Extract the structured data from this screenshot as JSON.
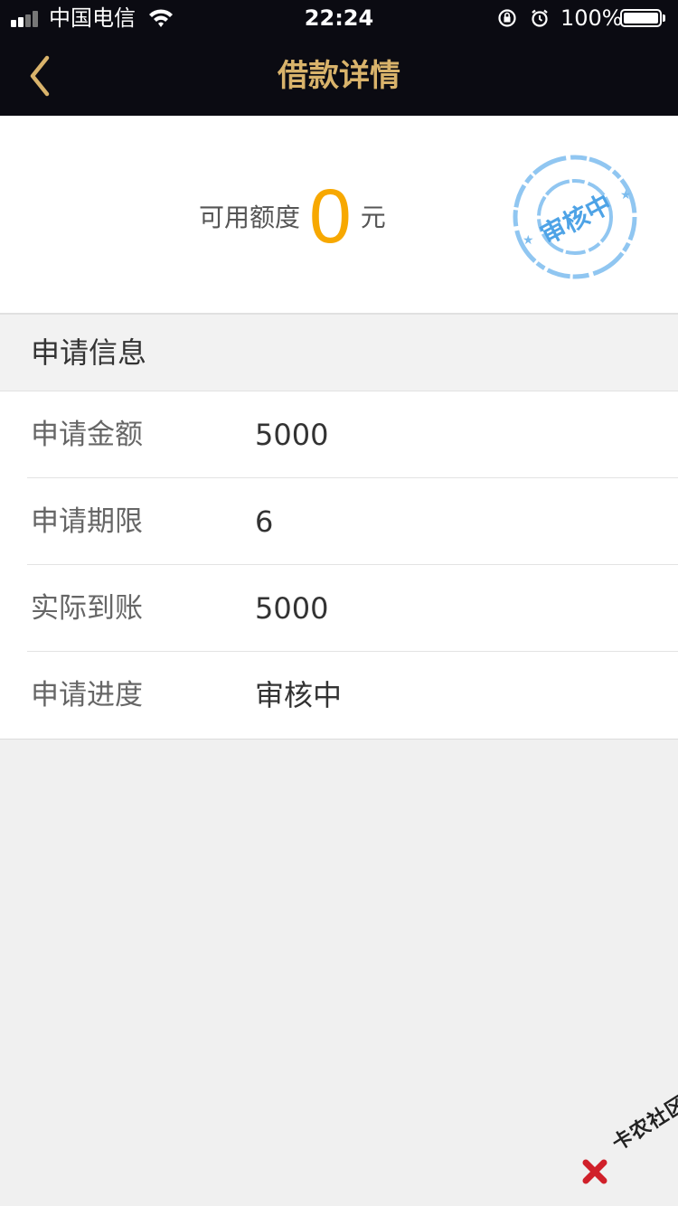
{
  "status_bar": {
    "carrier": "中国电信",
    "time": "22:24",
    "battery": "100%"
  },
  "nav": {
    "title": "借款详情",
    "back_icon": "chevron-left-icon",
    "title_color": "#d9b36b"
  },
  "quota": {
    "label": "可用额度",
    "value": "0",
    "unit": "元",
    "value_color": "#f7a800"
  },
  "stamp": {
    "text": "审核中",
    "color": "#6fb3e8"
  },
  "section": {
    "title": "申请信息"
  },
  "info_rows": [
    {
      "label": "申请金额",
      "value": "5000"
    },
    {
      "label": "申请期限",
      "value": "6"
    },
    {
      "label": "实际到账",
      "value": "5000"
    },
    {
      "label": "申请进度",
      "value": "审核中"
    }
  ],
  "watermark": {
    "text": "卡农社区"
  }
}
